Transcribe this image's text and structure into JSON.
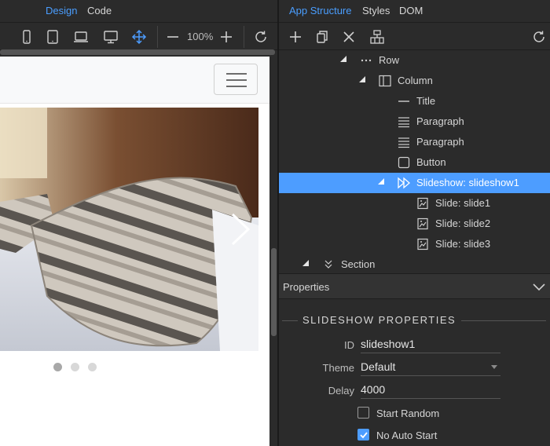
{
  "left_tabs": {
    "design": "Design",
    "code": "Code"
  },
  "zoom": {
    "value": "100%"
  },
  "right_tabs": {
    "app_structure": "App Structure",
    "styles": "Styles",
    "dom": "DOM"
  },
  "tree": [
    {
      "label": "Row",
      "icon": "dots-icon"
    },
    {
      "label": "Column",
      "icon": "column-icon"
    },
    {
      "label": "Title",
      "icon": "title-icon"
    },
    {
      "label": "Paragraph",
      "icon": "paragraph-icon"
    },
    {
      "label": "Paragraph",
      "icon": "paragraph-icon"
    },
    {
      "label": "Button",
      "icon": "button-icon"
    },
    {
      "label": "Slideshow: slideshow1",
      "icon": "slideshow-icon"
    },
    {
      "label": "Slide: slide1",
      "icon": "slide-icon"
    },
    {
      "label": "Slide: slide2",
      "icon": "slide-icon"
    },
    {
      "label": "Slide: slide3",
      "icon": "slide-icon"
    },
    {
      "label": "Section",
      "icon": "section-icon"
    }
  ],
  "properties": {
    "header": "Properties",
    "section_title": "SLIDESHOW PROPERTIES",
    "id_label": "ID",
    "id_value": "slideshow1",
    "theme_label": "Theme",
    "theme_value": "Default",
    "delay_label": "Delay",
    "delay_value": "4000",
    "start_random_label": "Start Random",
    "start_random_checked": false,
    "no_auto_start_label": "No Auto Start",
    "no_auto_start_checked": true
  },
  "carousel": {
    "slide_count": 3,
    "active_index": 0
  },
  "colors": {
    "accent": "#4d9dff",
    "panel_bg": "#2b2b2b",
    "selected_row": "#4d9dff"
  }
}
